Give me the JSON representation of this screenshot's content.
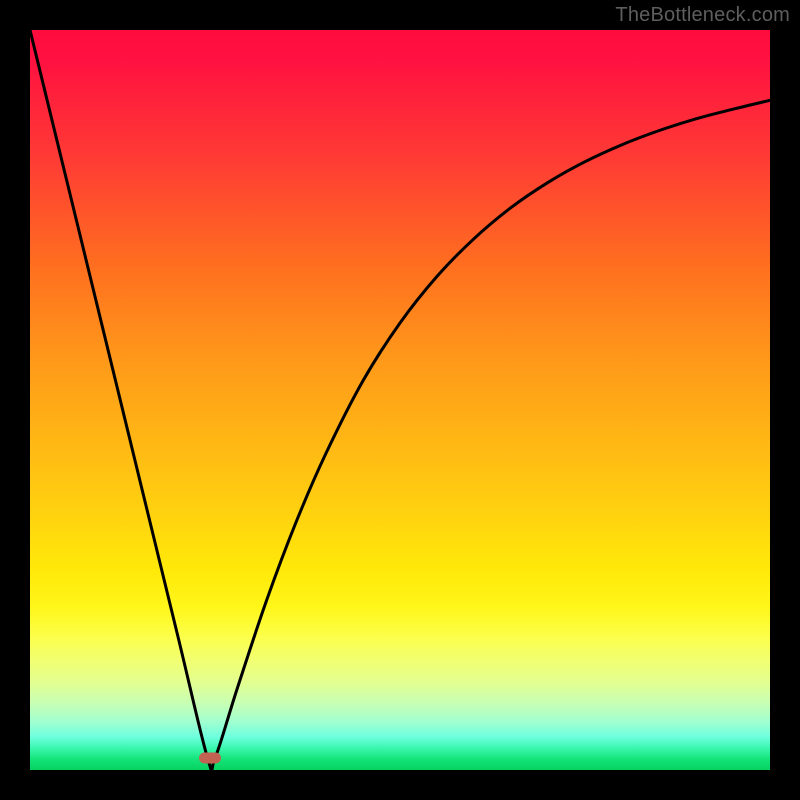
{
  "watermark": "TheBottleneck.com",
  "colors": {
    "marker": "#c26252",
    "curve": "#000000",
    "frame": "#000000"
  },
  "chart_data": {
    "type": "line",
    "title": "",
    "xlabel": "",
    "ylabel": "",
    "xlim": [
      0,
      100
    ],
    "ylim": [
      0,
      100
    ],
    "grid": false,
    "legend": false,
    "series": [
      {
        "name": "curve",
        "x": [
          0,
          5,
          10,
          15,
          20,
          24,
          25,
          28,
          32,
          36,
          40,
          45,
          50,
          55,
          60,
          65,
          70,
          75,
          80,
          85,
          90,
          95,
          100
        ],
        "y": [
          100,
          79.5,
          59,
          38.5,
          18,
          1.6,
          1.6,
          11,
          23,
          33.6,
          42.8,
          52.6,
          60.4,
          66.7,
          71.8,
          76,
          79.4,
          82.2,
          84.5,
          86.4,
          88,
          89.3,
          90.5
        ]
      }
    ],
    "marker": {
      "x": 24.3,
      "y": 1.6
    }
  }
}
